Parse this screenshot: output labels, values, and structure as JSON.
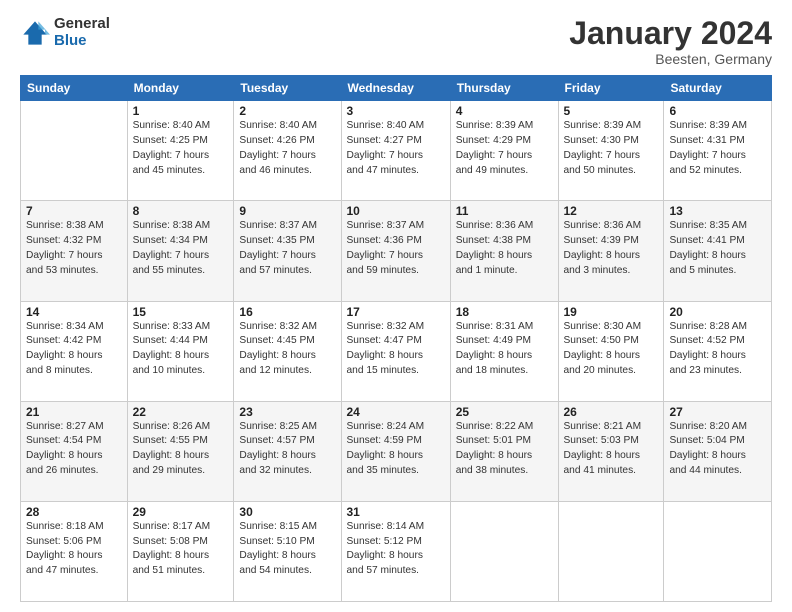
{
  "logo": {
    "general": "General",
    "blue": "Blue"
  },
  "header": {
    "title": "January 2024",
    "location": "Beesten, Germany"
  },
  "weekdays": [
    "Sunday",
    "Monday",
    "Tuesday",
    "Wednesday",
    "Thursday",
    "Friday",
    "Saturday"
  ],
  "weeks": [
    [
      {
        "day": "",
        "info": ""
      },
      {
        "day": "1",
        "info": "Sunrise: 8:40 AM\nSunset: 4:25 PM\nDaylight: 7 hours\nand 45 minutes."
      },
      {
        "day": "2",
        "info": "Sunrise: 8:40 AM\nSunset: 4:26 PM\nDaylight: 7 hours\nand 46 minutes."
      },
      {
        "day": "3",
        "info": "Sunrise: 8:40 AM\nSunset: 4:27 PM\nDaylight: 7 hours\nand 47 minutes."
      },
      {
        "day": "4",
        "info": "Sunrise: 8:39 AM\nSunset: 4:29 PM\nDaylight: 7 hours\nand 49 minutes."
      },
      {
        "day": "5",
        "info": "Sunrise: 8:39 AM\nSunset: 4:30 PM\nDaylight: 7 hours\nand 50 minutes."
      },
      {
        "day": "6",
        "info": "Sunrise: 8:39 AM\nSunset: 4:31 PM\nDaylight: 7 hours\nand 52 minutes."
      }
    ],
    [
      {
        "day": "7",
        "info": "Sunrise: 8:38 AM\nSunset: 4:32 PM\nDaylight: 7 hours\nand 53 minutes."
      },
      {
        "day": "8",
        "info": "Sunrise: 8:38 AM\nSunset: 4:34 PM\nDaylight: 7 hours\nand 55 minutes."
      },
      {
        "day": "9",
        "info": "Sunrise: 8:37 AM\nSunset: 4:35 PM\nDaylight: 7 hours\nand 57 minutes."
      },
      {
        "day": "10",
        "info": "Sunrise: 8:37 AM\nSunset: 4:36 PM\nDaylight: 7 hours\nand 59 minutes."
      },
      {
        "day": "11",
        "info": "Sunrise: 8:36 AM\nSunset: 4:38 PM\nDaylight: 8 hours\nand 1 minute."
      },
      {
        "day": "12",
        "info": "Sunrise: 8:36 AM\nSunset: 4:39 PM\nDaylight: 8 hours\nand 3 minutes."
      },
      {
        "day": "13",
        "info": "Sunrise: 8:35 AM\nSunset: 4:41 PM\nDaylight: 8 hours\nand 5 minutes."
      }
    ],
    [
      {
        "day": "14",
        "info": "Sunrise: 8:34 AM\nSunset: 4:42 PM\nDaylight: 8 hours\nand 8 minutes."
      },
      {
        "day": "15",
        "info": "Sunrise: 8:33 AM\nSunset: 4:44 PM\nDaylight: 8 hours\nand 10 minutes."
      },
      {
        "day": "16",
        "info": "Sunrise: 8:32 AM\nSunset: 4:45 PM\nDaylight: 8 hours\nand 12 minutes."
      },
      {
        "day": "17",
        "info": "Sunrise: 8:32 AM\nSunset: 4:47 PM\nDaylight: 8 hours\nand 15 minutes."
      },
      {
        "day": "18",
        "info": "Sunrise: 8:31 AM\nSunset: 4:49 PM\nDaylight: 8 hours\nand 18 minutes."
      },
      {
        "day": "19",
        "info": "Sunrise: 8:30 AM\nSunset: 4:50 PM\nDaylight: 8 hours\nand 20 minutes."
      },
      {
        "day": "20",
        "info": "Sunrise: 8:28 AM\nSunset: 4:52 PM\nDaylight: 8 hours\nand 23 minutes."
      }
    ],
    [
      {
        "day": "21",
        "info": "Sunrise: 8:27 AM\nSunset: 4:54 PM\nDaylight: 8 hours\nand 26 minutes."
      },
      {
        "day": "22",
        "info": "Sunrise: 8:26 AM\nSunset: 4:55 PM\nDaylight: 8 hours\nand 29 minutes."
      },
      {
        "day": "23",
        "info": "Sunrise: 8:25 AM\nSunset: 4:57 PM\nDaylight: 8 hours\nand 32 minutes."
      },
      {
        "day": "24",
        "info": "Sunrise: 8:24 AM\nSunset: 4:59 PM\nDaylight: 8 hours\nand 35 minutes."
      },
      {
        "day": "25",
        "info": "Sunrise: 8:22 AM\nSunset: 5:01 PM\nDaylight: 8 hours\nand 38 minutes."
      },
      {
        "day": "26",
        "info": "Sunrise: 8:21 AM\nSunset: 5:03 PM\nDaylight: 8 hours\nand 41 minutes."
      },
      {
        "day": "27",
        "info": "Sunrise: 8:20 AM\nSunset: 5:04 PM\nDaylight: 8 hours\nand 44 minutes."
      }
    ],
    [
      {
        "day": "28",
        "info": "Sunrise: 8:18 AM\nSunset: 5:06 PM\nDaylight: 8 hours\nand 47 minutes."
      },
      {
        "day": "29",
        "info": "Sunrise: 8:17 AM\nSunset: 5:08 PM\nDaylight: 8 hours\nand 51 minutes."
      },
      {
        "day": "30",
        "info": "Sunrise: 8:15 AM\nSunset: 5:10 PM\nDaylight: 8 hours\nand 54 minutes."
      },
      {
        "day": "31",
        "info": "Sunrise: 8:14 AM\nSunset: 5:12 PM\nDaylight: 8 hours\nand 57 minutes."
      },
      {
        "day": "",
        "info": ""
      },
      {
        "day": "",
        "info": ""
      },
      {
        "day": "",
        "info": ""
      }
    ]
  ]
}
